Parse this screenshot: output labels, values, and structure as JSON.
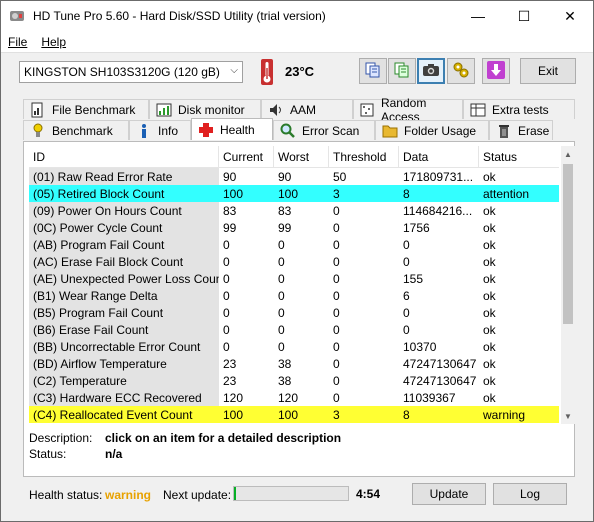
{
  "window": {
    "title": "HD Tune Pro 5.60 - Hard Disk/SSD Utility (trial version)",
    "controls": {
      "minimize": "—",
      "maximize": "☐",
      "close": "✕"
    }
  },
  "menu": {
    "file": "File",
    "help": "Help"
  },
  "toolbar": {
    "drive": "KINGSTON SH103S3120G (120 gB)",
    "temperature": "23°C",
    "exit_label": "Exit",
    "icons": [
      "copy-info-icon",
      "copy-text-icon",
      "screenshot-icon",
      "options-icon",
      "save-icon"
    ]
  },
  "tabs": {
    "row1": [
      "File Benchmark",
      "Disk monitor",
      "AAM",
      "Random Access",
      "Extra tests"
    ],
    "row2": [
      "Benchmark",
      "Info",
      "Health",
      "Error Scan",
      "Folder Usage",
      "Erase"
    ],
    "selected": "Health"
  },
  "table": {
    "columns": [
      "ID",
      "Current",
      "Worst",
      "Threshold",
      "Data",
      "Status"
    ],
    "rows": [
      {
        "id": "(01) Raw Read Error Rate",
        "current": "90",
        "worst": "90",
        "threshold": "50",
        "data": "171809731...",
        "status": "ok",
        "highlight": ""
      },
      {
        "id": "(05) Retired Block Count",
        "current": "100",
        "worst": "100",
        "threshold": "3",
        "data": "8",
        "status": "attention",
        "highlight": "attention"
      },
      {
        "id": "(09) Power On Hours Count",
        "current": "83",
        "worst": "83",
        "threshold": "0",
        "data": "114684216...",
        "status": "ok",
        "highlight": ""
      },
      {
        "id": "(0C) Power Cycle Count",
        "current": "99",
        "worst": "99",
        "threshold": "0",
        "data": "1756",
        "status": "ok",
        "highlight": ""
      },
      {
        "id": "(AB) Program Fail Count",
        "current": "0",
        "worst": "0",
        "threshold": "0",
        "data": "0",
        "status": "ok",
        "highlight": ""
      },
      {
        "id": "(AC) Erase Fail Block Count",
        "current": "0",
        "worst": "0",
        "threshold": "0",
        "data": "0",
        "status": "ok",
        "highlight": ""
      },
      {
        "id": "(AE) Unexpected Power Loss Count",
        "current": "0",
        "worst": "0",
        "threshold": "0",
        "data": "155",
        "status": "ok",
        "highlight": ""
      },
      {
        "id": "(B1) Wear Range Delta",
        "current": "0",
        "worst": "0",
        "threshold": "0",
        "data": "6",
        "status": "ok",
        "highlight": ""
      },
      {
        "id": "(B5) Program Fail Count",
        "current": "0",
        "worst": "0",
        "threshold": "0",
        "data": "0",
        "status": "ok",
        "highlight": ""
      },
      {
        "id": "(B6) Erase Fail Count",
        "current": "0",
        "worst": "0",
        "threshold": "0",
        "data": "0",
        "status": "ok",
        "highlight": ""
      },
      {
        "id": "(BB) Uncorrectable Error Count",
        "current": "0",
        "worst": "0",
        "threshold": "0",
        "data": "10370",
        "status": "ok",
        "highlight": ""
      },
      {
        "id": "(BD) Airflow Temperature",
        "current": "23",
        "worst": "38",
        "threshold": "0",
        "data": "47247130647",
        "status": "ok",
        "highlight": ""
      },
      {
        "id": "(C2) Temperature",
        "current": "23",
        "worst": "38",
        "threshold": "0",
        "data": "47247130647",
        "status": "ok",
        "highlight": ""
      },
      {
        "id": "(C3) Hardware ECC Recovered",
        "current": "120",
        "worst": "120",
        "threshold": "0",
        "data": "11039367",
        "status": "ok",
        "highlight": ""
      },
      {
        "id": "(C4) Reallocated Event Count",
        "current": "100",
        "worst": "100",
        "threshold": "3",
        "data": "8",
        "status": "warning",
        "highlight": "warning"
      }
    ]
  },
  "details": {
    "description_label": "Description:",
    "description_value": "click on an item for a detailed description",
    "status_label": "Status:",
    "status_value": "n/a"
  },
  "footer": {
    "health_label": "Health status:",
    "health_value": "warning",
    "next_update_label": "Next update:",
    "progress_fraction": 0.02,
    "countdown": "4:54",
    "update_label": "Update",
    "log_label": "Log"
  },
  "colors": {
    "attention_row": "#33ffff",
    "warning_row": "#ffff33",
    "health_warning_text": "#e8a200",
    "progress_fill": "#06b025"
  }
}
